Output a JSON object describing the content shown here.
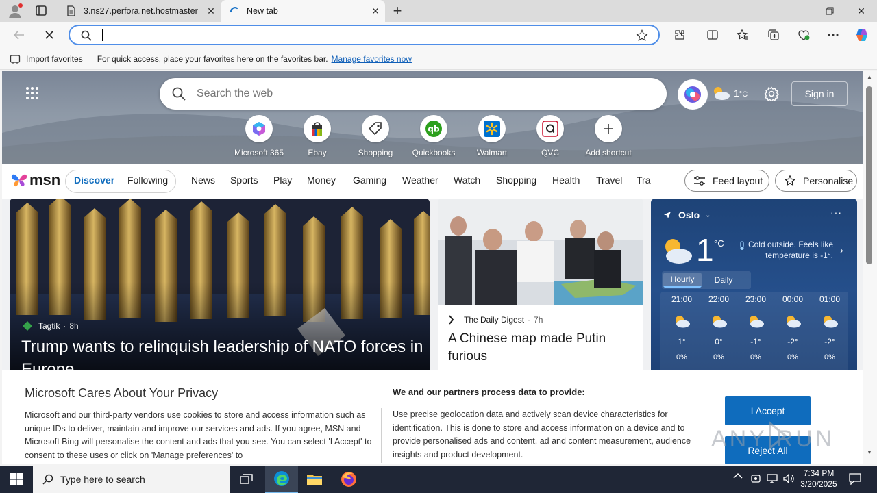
{
  "browser": {
    "tabs": [
      {
        "label": "3.ns27.perfora.net.hostmaster",
        "active": false
      },
      {
        "label": "New tab",
        "active": true
      }
    ],
    "address": {
      "value": "",
      "placeholder": ""
    },
    "favorites_bar": {
      "import_label": "Import favorites",
      "hint": "For quick access, place your favorites here on the favorites bar.",
      "manage_link": "Manage favorites now"
    }
  },
  "newtab": {
    "search_placeholder": "Search the web",
    "weather_temp": "1",
    "weather_unit": "°C",
    "signin_label": "Sign in",
    "shortcuts": [
      {
        "label": "Microsoft 365",
        "icon": "m365-icon"
      },
      {
        "label": "Ebay",
        "icon": "ebay-icon"
      },
      {
        "label": "Shopping",
        "icon": "shopping-tag-icon"
      },
      {
        "label": "Quickbooks",
        "icon": "quickbooks-icon"
      },
      {
        "label": "Walmart",
        "icon": "walmart-icon"
      },
      {
        "label": "QVC",
        "icon": "qvc-icon"
      },
      {
        "label": "Add shortcut",
        "icon": "plus-icon"
      }
    ]
  },
  "msn": {
    "logo": "msn",
    "segments": [
      "Discover",
      "Following"
    ],
    "nav": [
      "News",
      "Sports",
      "Play",
      "Money",
      "Gaming",
      "Weather",
      "Watch",
      "Shopping",
      "Health",
      "Travel",
      "Tra"
    ],
    "feed_layout": "Feed layout",
    "personalise": "Personalise"
  },
  "cards": {
    "main": {
      "source": "Tagtik",
      "age": "8h",
      "headline": "Trump wants to relinquish leadership of NATO forces in Europe"
    },
    "second": {
      "source": "The Daily Digest",
      "age": "7h",
      "headline": "A Chinese map made Putin furious"
    }
  },
  "weather_card": {
    "city": "Oslo",
    "temp": "1",
    "unit": "°C",
    "note": "Cold outside. Feels like temperature is -1°.",
    "tabs": [
      "Hourly",
      "Daily"
    ],
    "hours": [
      {
        "time": "21:00",
        "temp": "1°",
        "precip": "0%"
      },
      {
        "time": "22:00",
        "temp": "0°",
        "precip": "0%"
      },
      {
        "time": "23:00",
        "temp": "-1°",
        "precip": "0%"
      },
      {
        "time": "00:00",
        "temp": "-2°",
        "precip": "0%"
      },
      {
        "time": "01:00",
        "temp": "-2°",
        "precip": "0%"
      }
    ]
  },
  "privacy": {
    "title": "Microsoft Cares About Your Privacy",
    "body": "Microsoft and our third-party vendors use cookies to store and access information such as unique IDs to deliver, maintain and improve our services and ads. If you agree, MSN and Microsoft Bing will personalise the content and ads that you see. You can select 'I Accept' to consent to these uses or click on 'Manage preferences' to",
    "right_title": "We and our partners process data to provide:",
    "right_body": "Use precise geolocation data and actively scan device characteristics for identification. This is done to store and access information on a device and to provide personalised ads and content, ad and content measurement, audience insights and product development.",
    "accept": "I Accept",
    "reject": "Reject All"
  },
  "watermark": "ANY RUN",
  "taskbar": {
    "search_placeholder": "Type here to search",
    "time": "7:34 PM",
    "date": "3/20/2025"
  },
  "colors": {
    "accent": "#0f6cbd",
    "taskbar": "#1f2636",
    "weather_bg": "#254f8b"
  }
}
